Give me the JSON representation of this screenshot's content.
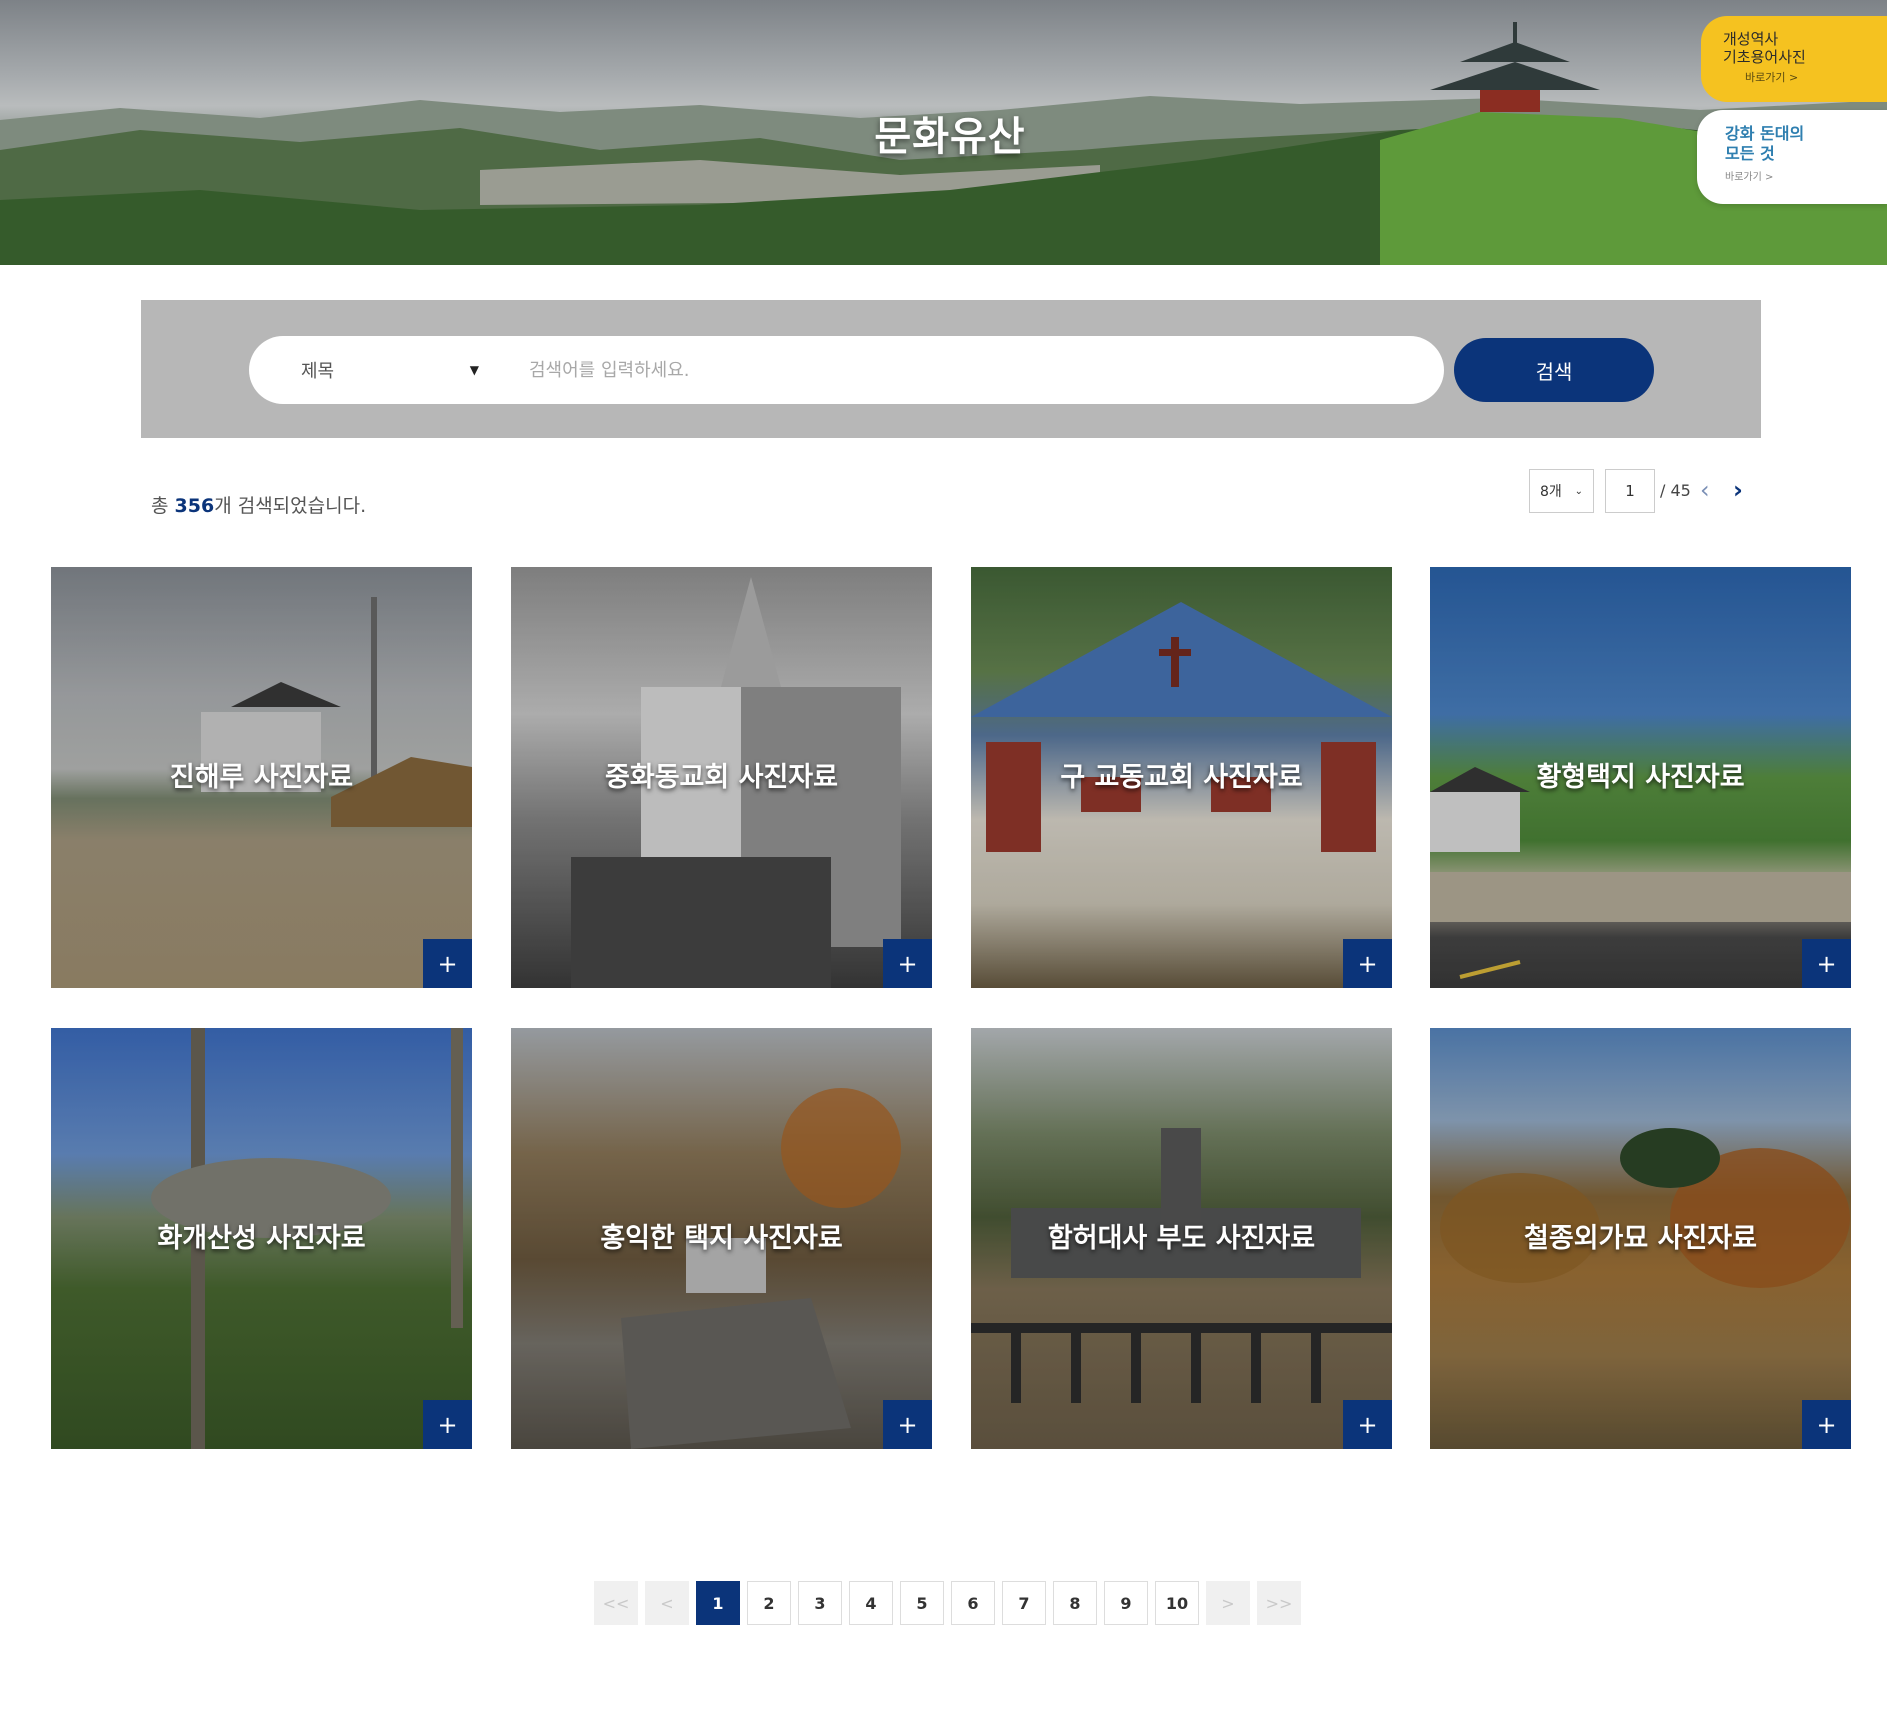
{
  "hero": {
    "title": "문화유산"
  },
  "quick_links": [
    {
      "line1": "개성역사",
      "line2": "기초용어사진",
      "go": "바로가기 >"
    },
    {
      "line1": "강화 돈대의",
      "line2": "모든 것",
      "go": "바로가기 >"
    }
  ],
  "search": {
    "field_select": "제목",
    "placeholder": "검색어를 입력하세요.",
    "button_label": "검색"
  },
  "results": {
    "prefix": "총 ",
    "count": "356",
    "suffix": "개 검색되었습니다."
  },
  "pager": {
    "per_page": "8개",
    "current_page": "1",
    "total_pages": "/ 45",
    "prev_icon": "‹",
    "next_icon": "›"
  },
  "cards": [
    {
      "title": "진해루 사진자료",
      "plus": "+"
    },
    {
      "title": "중화동교회 사진자료",
      "plus": "+"
    },
    {
      "title": "구 교동교회 사진자료",
      "plus": "+"
    },
    {
      "title": "황형택지 사진자료",
      "plus": "+"
    },
    {
      "title": "화개산성 사진자료",
      "plus": "+"
    },
    {
      "title": "홍익한 택지 사진자료",
      "plus": "+"
    },
    {
      "title": "함허대사 부도 사진자료",
      "plus": "+"
    },
    {
      "title": "철종외가묘 사진자료",
      "plus": "+"
    }
  ],
  "pagination": {
    "first": "<<",
    "prev": "<",
    "pages": [
      "1",
      "2",
      "3",
      "4",
      "5",
      "6",
      "7",
      "8",
      "9",
      "10"
    ],
    "next": ">",
    "last": ">>",
    "current": "1"
  },
  "colors": {
    "accent": "#0b347a",
    "quick_yellow": "#f5c220",
    "search_bg": "#b7b7b7"
  }
}
